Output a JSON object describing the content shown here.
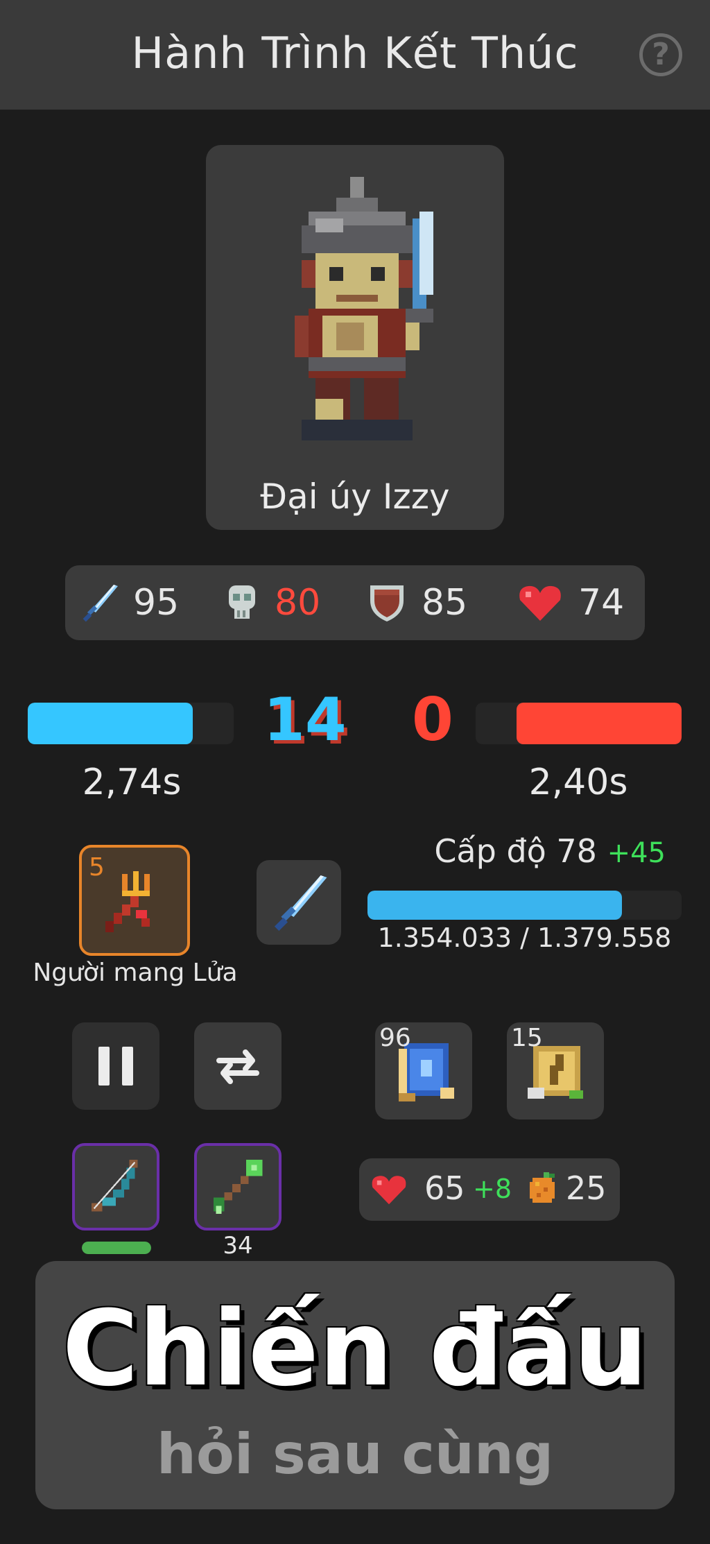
{
  "header": {
    "title": "Hành Trình Kết Thúc",
    "help_icon": "?"
  },
  "hero": {
    "name": "Đại úy Izzy"
  },
  "stats": {
    "attack": {
      "icon": "sword-icon",
      "value": "95"
    },
    "skull": {
      "icon": "skull-icon",
      "value": "80",
      "color": "#ff4a3d"
    },
    "defense": {
      "icon": "shield-icon",
      "value": "85"
    },
    "health": {
      "icon": "heart-icon",
      "value": "74"
    }
  },
  "combat": {
    "player_bar_fraction": 0.8,
    "player_time": "2,74s",
    "player_score": "14",
    "enemy_score": "0",
    "enemy_bar_fraction": 0.8,
    "enemy_time": "2,40s",
    "player_color": "#35c6ff",
    "enemy_color": "#ff4535"
  },
  "equipment": {
    "weapon_level": "5",
    "weapon_name": "Người mang Lửa"
  },
  "level": {
    "label": "Cấp độ 78",
    "bonus": "+45",
    "xp_text": "1.354.033 / 1.379.558",
    "xp_fraction": 0.81
  },
  "inventory": {
    "tome_count": "96",
    "scroll_count": "15",
    "arrow_count": "34",
    "bow_durability_fraction": 1.0
  },
  "resources": {
    "hearts": "65",
    "hearts_bonus": "+8",
    "fruit": "25"
  },
  "battle_button": {
    "title": "Chiến đấu",
    "subtitle": "hỏi sau cùng"
  }
}
